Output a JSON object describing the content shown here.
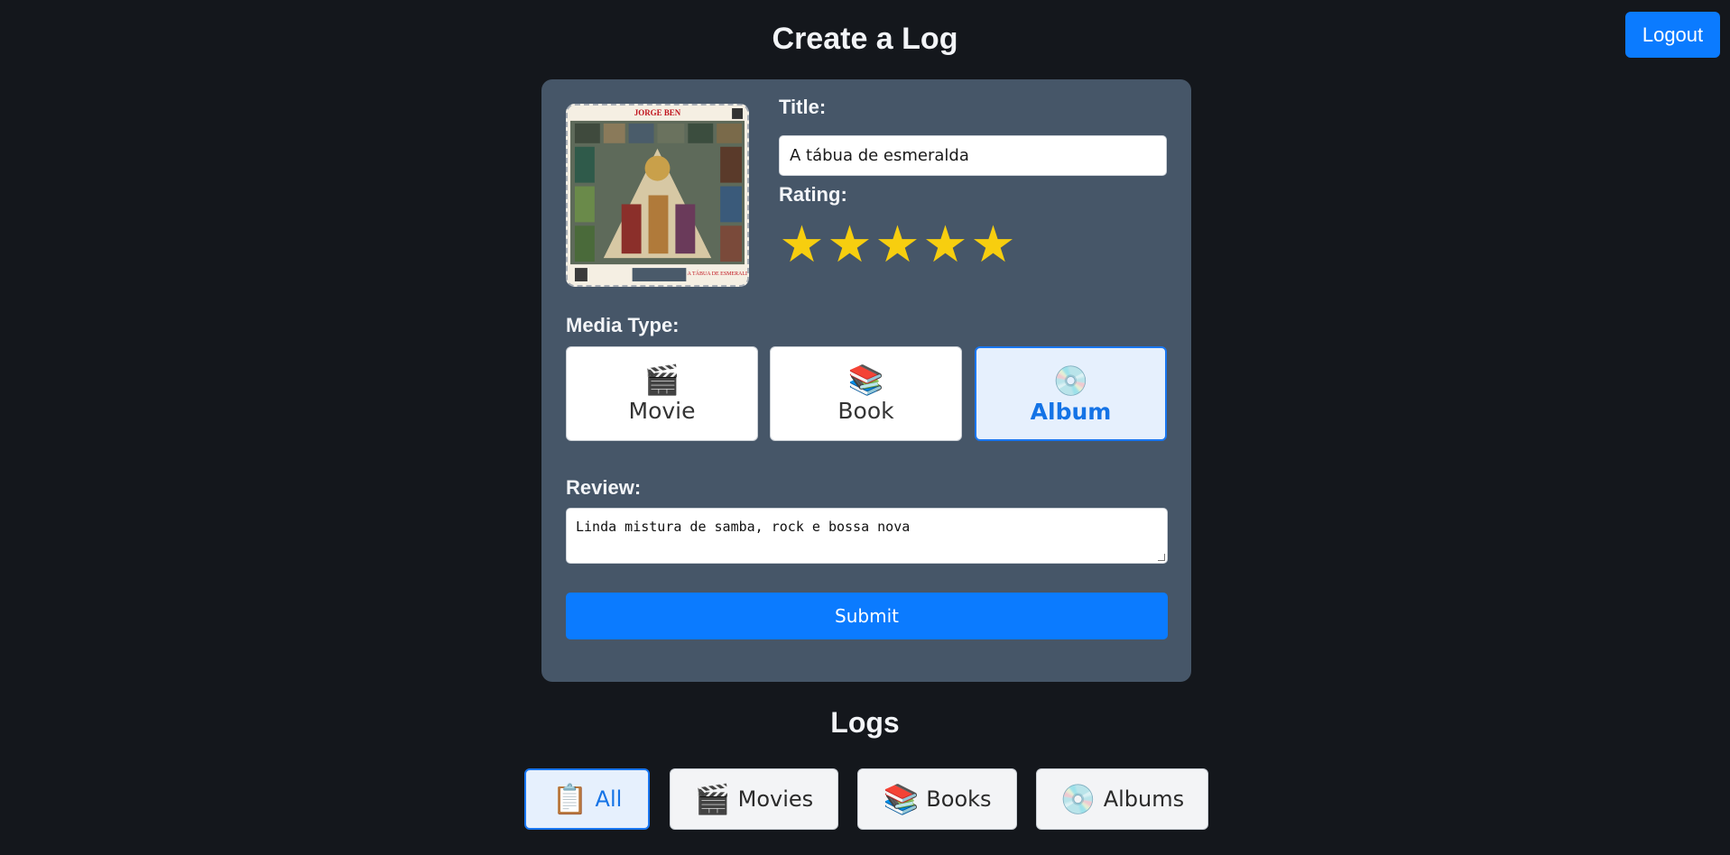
{
  "header": {
    "logout_label": "Logout",
    "page_title": "Create a Log"
  },
  "form": {
    "cover_alt": "Album cover",
    "cover_text": {
      "artist": "JORGE BEN",
      "album": "A TÁBUA DE ESMERALDA"
    },
    "title_label": "Title:",
    "title_value": "A tábua de esmeralda",
    "rating_label": "Rating:",
    "rating": {
      "value": 5,
      "max": 5,
      "star_glyph": "★",
      "star_color": "#f7ce0f"
    },
    "media_label": "Media Type:",
    "media_types": [
      {
        "icon": "🎬",
        "label": "Movie",
        "icon_name": "clapper-icon"
      },
      {
        "icon": "📚",
        "label": "Book",
        "icon_name": "books-icon"
      },
      {
        "icon": "💿",
        "label": "Album",
        "icon_name": "disc-icon"
      }
    ],
    "selected_media": "Album",
    "review_label": "Review:",
    "review_value": "Linda mistura de samba, rock e bossa nova",
    "submit_label": "Submit"
  },
  "logs": {
    "title": "Logs",
    "filters": [
      {
        "icon": "📋",
        "label": "All"
      },
      {
        "icon": "🎬",
        "label": "Movies"
      },
      {
        "icon": "📚",
        "label": "Books"
      },
      {
        "icon": "💿",
        "label": "Albums"
      }
    ],
    "active_filter": "All"
  },
  "colors": {
    "accent": "#0b7bff",
    "background": "#14171c",
    "card": "#465668"
  }
}
